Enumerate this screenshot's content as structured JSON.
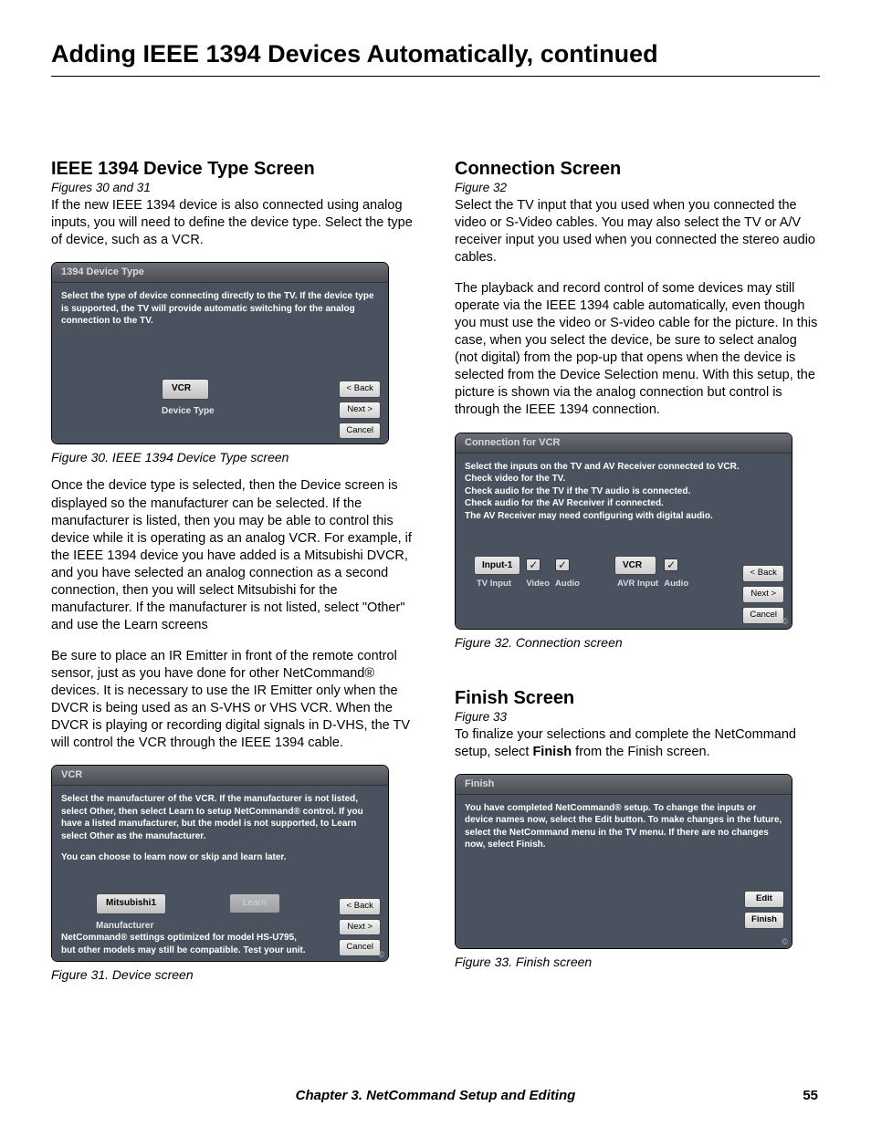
{
  "page": {
    "title": "Adding IEEE 1394 Devices Automatically, continued",
    "chapter_footer": "Chapter 3. NetCommand Setup and Editing",
    "page_number": "55"
  },
  "left": {
    "h1": "IEEE 1394 Device Type Screen",
    "figref1": "Figures 30 and 31",
    "p1": "If the new IEEE 1394 device is also connected using analog inputs, you will need to define the device type. Select the type of device, such as a VCR.",
    "fig30": {
      "title": "1394 Device Type",
      "instr": "Select the type of device connecting directly to the TV. If the device type is supported, the TV will provide automatic switching for the analog connection to the TV.",
      "select_value": "VCR",
      "select_label": "Device Type",
      "btn_back": "< Back",
      "btn_next": "Next >",
      "btn_cancel": "Cancel",
      "caption": "Figure 30. IEEE 1394 Device Type screen"
    },
    "p2": "Once the device type is selected, then the Device screen is displayed so the manufacturer can be selected. If the manufacturer is listed, then you may be able to control this device while it is operating as an analog VCR. For example, if the IEEE 1394 device you have added is a Mitsubishi DVCR, and you have selected an analog connection as a second connection, then you will select Mitsubishi for the manufacturer. If the manufacturer is not listed, select \"Other\" and use the Learn screens",
    "p3": "Be sure to place an IR Emitter in front of the remote control sensor, just as you have done for other NetCommand® devices. It is necessary to use the IR Emitter only when the DVCR is being used as an S-VHS or VHS VCR. When the DVCR is playing or recording digital signals in D-VHS, the TV will control the VCR through the IEEE 1394 cable.",
    "fig31": {
      "title": "VCR",
      "instr1": "Select the manufacturer of the VCR. If the manufacturer is not listed, select Other, then select Learn to setup NetCommand® control. If you have a listed manufacturer, but the model is not supported, to Learn select Other as the manufacturer.",
      "instr2": "You can choose to learn now or skip and learn later.",
      "select_value": "Mitsubishi1",
      "select_label": "Manufacturer",
      "learn_label": "Learn",
      "note": "NetCommand® settings optimized for model HS-U795, but other models may still be compatible. Test your unit.",
      "btn_back": "< Back",
      "btn_next": "Next >",
      "btn_cancel": "Cancel",
      "caption": "Figure 31.  Device  screen"
    }
  },
  "right": {
    "h1": "Connection Screen",
    "figref1": "Figure 32",
    "p1": "Select the TV input that you used when you connected the video or S-Video cables. You may also select the TV or A/V receiver input you used when you connected the stereo audio cables.",
    "p2": "The playback and record control of some devices may still operate via the IEEE 1394 cable automatically, even though you must use the video or S-video cable for the picture. In this case, when you select the device, be sure to select analog (not digital) from the pop-up that opens when the device is selected from the Device Selection menu. With this setup, the picture is shown via the analog connection but control is through the IEEE 1394 connection.",
    "fig32": {
      "title": "Connection for VCR",
      "line1": "Select the inputs on the TV and AV Receiver connected to VCR.",
      "line2": "Check video for the TV.",
      "line3": "Check audio for the TV if the TV audio is connected.",
      "line4": "Check audio for the AV Receiver if connected.",
      "line5a": "The AV Receiver may need configuring ",
      "line5b": "with digital",
      "line5c": " audio.",
      "tv_input_val": "Input-1",
      "tv_input_label": "TV Input",
      "col_video": "Video",
      "col_audio": "Audio",
      "avr_input_val": "VCR",
      "avr_input_label": "AVR Input",
      "avr_audio_label": "Audio",
      "btn_back": "< Back",
      "btn_next": "Next >",
      "btn_cancel": "Cancel",
      "caption": "Figure 32. Connection screen"
    },
    "h2": "Finish Screen",
    "figref2": "Figure 33",
    "p3a": "To finalize your selections and complete the NetCommand setup, select ",
    "p3b": "Finish",
    "p3c": " from the Finish screen.",
    "fig33": {
      "title": "Finish",
      "instr": "You have completed NetCommand® setup. To change the inputs or device names now, select the Edit button. To make changes in the future, select the NetCommand menu in the TV menu. If there are no changes now, select Finish.",
      "btn_edit": "Edit",
      "btn_finish": "Finish",
      "caption": "Figure 33. Finish screen"
    }
  }
}
